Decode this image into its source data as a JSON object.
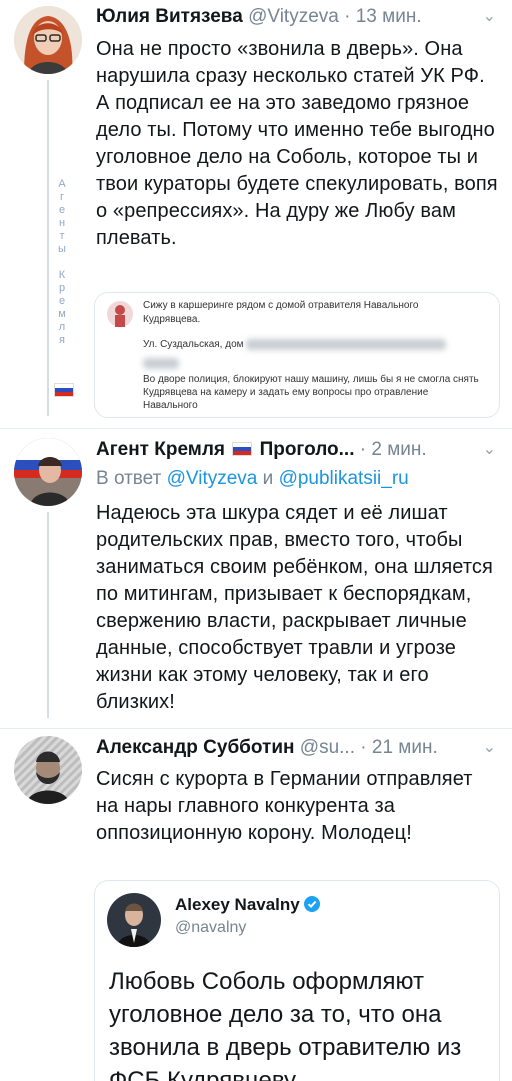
{
  "tweets": [
    {
      "name": "Юлия Витязева",
      "handle": "@Vityzeva",
      "sep": "·",
      "time": "13 мин.",
      "body": "Она не просто «звонила в дверь». Она нарушила сразу несколько статей УК РФ. А подписал ее на это заведомо грязное дело ты. Потому что именно тебе выгодно уголовное дело на Соболь, которое ты и твои кураторы будете спекулировать, вопя о «репрессиях». На дуру же Любу вам плевать.",
      "embed": {
        "line1": "Сижу в каршеринге рядом с домой отравителя Навального Кудрявцева.",
        "line2": "Ул. Суздальская, дом",
        "line3": "Во дворе полиция, блокируют нашу машину, лишь бы я не смогла снять Кудрявцева на камеру и задать ему вопросы про отравление Навального"
      },
      "vertical_text": "Агенты Кремля"
    },
    {
      "name": "Агент Кремля",
      "name_suffix": "Проголо...",
      "sep": "·",
      "time": "2 мин.",
      "reply_prefix": "В ответ",
      "reply_to_1": "@Vityzeva",
      "reply_and": "и",
      "reply_to_2": "@publikatsii_ru",
      "body": "Надеюсь эта шкура сядет и её лишат родительских прав, вместо того, чтобы заниматься своим ребёнком, она шляется по митингам, призывает к беспорядкам, свержению власти, раскрывает личные данные, способствует травли и угрозе жизни как этому человеку, так и его близких!"
    },
    {
      "name": "Александр Субботин",
      "handle": "@su...",
      "sep": "·",
      "time": "21 мин.",
      "body": "Сисян с курорта в Германии отправляет на нары главного конкурента за оппозиционную корону. Молодец!",
      "quote": {
        "name": "Alexey Navalny",
        "handle": "@navalny",
        "text": "Любовь Соболь оформляют уголовное дело за то, что она звонила в дверь отравителю из ФСБ Кудрявцеву."
      }
    }
  ],
  "colors": {
    "link": "#1b95e0",
    "muted": "#778592",
    "verified": "#1da1f2"
  },
  "icons": [
    "chevron-down-icon",
    "russian-flag-icon",
    "verified-badge-icon"
  ]
}
